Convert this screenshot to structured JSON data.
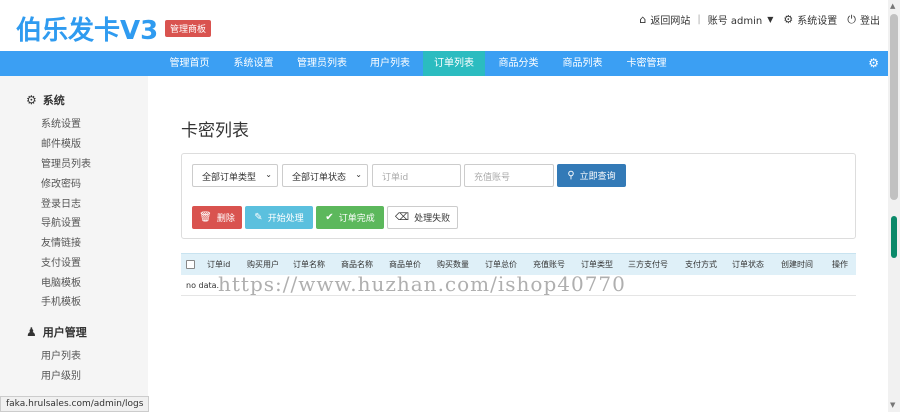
{
  "header": {
    "logo": "伯乐发卡V3",
    "badge": "管理商板",
    "links": {
      "home": "返回网站",
      "account": "账号 admin",
      "settings": "系统设置",
      "logout": "登出"
    }
  },
  "nav": {
    "items": [
      "管理首页",
      "系统设置",
      "管理员列表",
      "用户列表",
      "订单列表",
      "商品分类",
      "商品列表",
      "卡密管理"
    ],
    "active": "订单列表"
  },
  "sidebar": {
    "sections": [
      {
        "title": "系统",
        "items": [
          "系统设置",
          "邮件模版",
          "管理员列表",
          "修改密码",
          "登录日志",
          "导航设置",
          "友情链接",
          "支付设置",
          "电脑模板",
          "手机模板"
        ]
      },
      {
        "title": "用户管理",
        "items": [
          "用户列表",
          "用户级别"
        ]
      }
    ]
  },
  "status_url": "faka.hrulsales.com/admin/logs",
  "main": {
    "title": "卡密列表",
    "filters": {
      "order_type": "全部订单类型",
      "order_status": "全部订单状态",
      "order_id_placeholder": "订单id",
      "account_placeholder": "充值账号",
      "query_button": "立即查询"
    },
    "actions": {
      "delete": "删除",
      "start": "开始处理",
      "complete": "订单完成",
      "fail": "处理失败"
    },
    "table": {
      "columns": [
        "订单id",
        "购买用户",
        "订单名称",
        "商品名称",
        "商品单价",
        "购买数量",
        "订单总价",
        "充值账号",
        "订单类型",
        "三方支付号",
        "支付方式",
        "订单状态",
        "创建时间",
        "操作"
      ],
      "empty_text": "no data."
    }
  },
  "watermark": "https://www.huzhan.com/ishop40770",
  "colors": {
    "nav": "#3b9ff3",
    "nav_active": "#2bbcc0",
    "logo": "#2f9bf0",
    "danger": "#d9534f",
    "info": "#5bc0de",
    "success": "#5cb85c",
    "primary": "#337ab7"
  }
}
